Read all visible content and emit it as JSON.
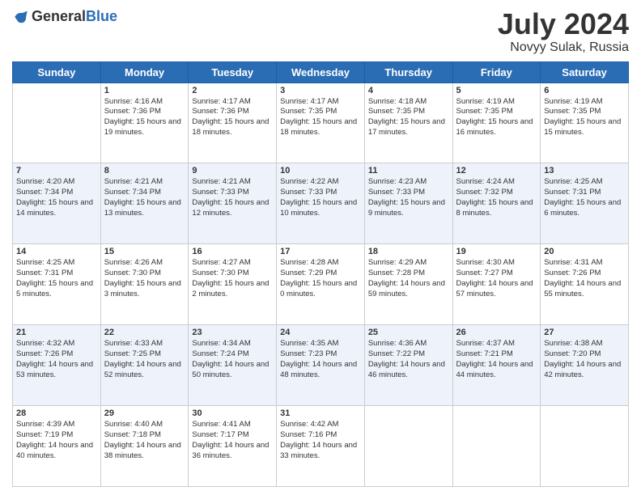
{
  "header": {
    "logo_general": "General",
    "logo_blue": "Blue",
    "title": "July 2024",
    "subtitle": "Novyy Sulak, Russia"
  },
  "days_of_week": [
    "Sunday",
    "Monday",
    "Tuesday",
    "Wednesday",
    "Thursday",
    "Friday",
    "Saturday"
  ],
  "weeks": [
    [
      {
        "day": "",
        "sunrise": "",
        "sunset": "",
        "daylight": ""
      },
      {
        "day": "1",
        "sunrise": "Sunrise: 4:16 AM",
        "sunset": "Sunset: 7:36 PM",
        "daylight": "Daylight: 15 hours and 19 minutes."
      },
      {
        "day": "2",
        "sunrise": "Sunrise: 4:17 AM",
        "sunset": "Sunset: 7:36 PM",
        "daylight": "Daylight: 15 hours and 18 minutes."
      },
      {
        "day": "3",
        "sunrise": "Sunrise: 4:17 AM",
        "sunset": "Sunset: 7:35 PM",
        "daylight": "Daylight: 15 hours and 18 minutes."
      },
      {
        "day": "4",
        "sunrise": "Sunrise: 4:18 AM",
        "sunset": "Sunset: 7:35 PM",
        "daylight": "Daylight: 15 hours and 17 minutes."
      },
      {
        "day": "5",
        "sunrise": "Sunrise: 4:19 AM",
        "sunset": "Sunset: 7:35 PM",
        "daylight": "Daylight: 15 hours and 16 minutes."
      },
      {
        "day": "6",
        "sunrise": "Sunrise: 4:19 AM",
        "sunset": "Sunset: 7:35 PM",
        "daylight": "Daylight: 15 hours and 15 minutes."
      }
    ],
    [
      {
        "day": "7",
        "sunrise": "Sunrise: 4:20 AM",
        "sunset": "Sunset: 7:34 PM",
        "daylight": "Daylight: 15 hours and 14 minutes."
      },
      {
        "day": "8",
        "sunrise": "Sunrise: 4:21 AM",
        "sunset": "Sunset: 7:34 PM",
        "daylight": "Daylight: 15 hours and 13 minutes."
      },
      {
        "day": "9",
        "sunrise": "Sunrise: 4:21 AM",
        "sunset": "Sunset: 7:33 PM",
        "daylight": "Daylight: 15 hours and 12 minutes."
      },
      {
        "day": "10",
        "sunrise": "Sunrise: 4:22 AM",
        "sunset": "Sunset: 7:33 PM",
        "daylight": "Daylight: 15 hours and 10 minutes."
      },
      {
        "day": "11",
        "sunrise": "Sunrise: 4:23 AM",
        "sunset": "Sunset: 7:33 PM",
        "daylight": "Daylight: 15 hours and 9 minutes."
      },
      {
        "day": "12",
        "sunrise": "Sunrise: 4:24 AM",
        "sunset": "Sunset: 7:32 PM",
        "daylight": "Daylight: 15 hours and 8 minutes."
      },
      {
        "day": "13",
        "sunrise": "Sunrise: 4:25 AM",
        "sunset": "Sunset: 7:31 PM",
        "daylight": "Daylight: 15 hours and 6 minutes."
      }
    ],
    [
      {
        "day": "14",
        "sunrise": "Sunrise: 4:25 AM",
        "sunset": "Sunset: 7:31 PM",
        "daylight": "Daylight: 15 hours and 5 minutes."
      },
      {
        "day": "15",
        "sunrise": "Sunrise: 4:26 AM",
        "sunset": "Sunset: 7:30 PM",
        "daylight": "Daylight: 15 hours and 3 minutes."
      },
      {
        "day": "16",
        "sunrise": "Sunrise: 4:27 AM",
        "sunset": "Sunset: 7:30 PM",
        "daylight": "Daylight: 15 hours and 2 minutes."
      },
      {
        "day": "17",
        "sunrise": "Sunrise: 4:28 AM",
        "sunset": "Sunset: 7:29 PM",
        "daylight": "Daylight: 15 hours and 0 minutes."
      },
      {
        "day": "18",
        "sunrise": "Sunrise: 4:29 AM",
        "sunset": "Sunset: 7:28 PM",
        "daylight": "Daylight: 14 hours and 59 minutes."
      },
      {
        "day": "19",
        "sunrise": "Sunrise: 4:30 AM",
        "sunset": "Sunset: 7:27 PM",
        "daylight": "Daylight: 14 hours and 57 minutes."
      },
      {
        "day": "20",
        "sunrise": "Sunrise: 4:31 AM",
        "sunset": "Sunset: 7:26 PM",
        "daylight": "Daylight: 14 hours and 55 minutes."
      }
    ],
    [
      {
        "day": "21",
        "sunrise": "Sunrise: 4:32 AM",
        "sunset": "Sunset: 7:26 PM",
        "daylight": "Daylight: 14 hours and 53 minutes."
      },
      {
        "day": "22",
        "sunrise": "Sunrise: 4:33 AM",
        "sunset": "Sunset: 7:25 PM",
        "daylight": "Daylight: 14 hours and 52 minutes."
      },
      {
        "day": "23",
        "sunrise": "Sunrise: 4:34 AM",
        "sunset": "Sunset: 7:24 PM",
        "daylight": "Daylight: 14 hours and 50 minutes."
      },
      {
        "day": "24",
        "sunrise": "Sunrise: 4:35 AM",
        "sunset": "Sunset: 7:23 PM",
        "daylight": "Daylight: 14 hours and 48 minutes."
      },
      {
        "day": "25",
        "sunrise": "Sunrise: 4:36 AM",
        "sunset": "Sunset: 7:22 PM",
        "daylight": "Daylight: 14 hours and 46 minutes."
      },
      {
        "day": "26",
        "sunrise": "Sunrise: 4:37 AM",
        "sunset": "Sunset: 7:21 PM",
        "daylight": "Daylight: 14 hours and 44 minutes."
      },
      {
        "day": "27",
        "sunrise": "Sunrise: 4:38 AM",
        "sunset": "Sunset: 7:20 PM",
        "daylight": "Daylight: 14 hours and 42 minutes."
      }
    ],
    [
      {
        "day": "28",
        "sunrise": "Sunrise: 4:39 AM",
        "sunset": "Sunset: 7:19 PM",
        "daylight": "Daylight: 14 hours and 40 minutes."
      },
      {
        "day": "29",
        "sunrise": "Sunrise: 4:40 AM",
        "sunset": "Sunset: 7:18 PM",
        "daylight": "Daylight: 14 hours and 38 minutes."
      },
      {
        "day": "30",
        "sunrise": "Sunrise: 4:41 AM",
        "sunset": "Sunset: 7:17 PM",
        "daylight": "Daylight: 14 hours and 36 minutes."
      },
      {
        "day": "31",
        "sunrise": "Sunrise: 4:42 AM",
        "sunset": "Sunset: 7:16 PM",
        "daylight": "Daylight: 14 hours and 33 minutes."
      },
      {
        "day": "",
        "sunrise": "",
        "sunset": "",
        "daylight": ""
      },
      {
        "day": "",
        "sunrise": "",
        "sunset": "",
        "daylight": ""
      },
      {
        "day": "",
        "sunrise": "",
        "sunset": "",
        "daylight": ""
      }
    ]
  ]
}
